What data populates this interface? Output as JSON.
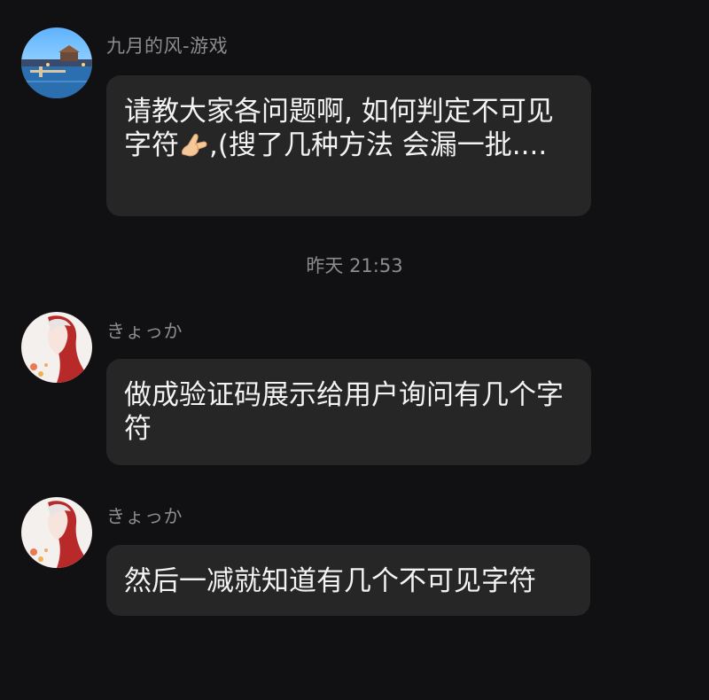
{
  "messages": [
    {
      "sender": "九月的风-游戏",
      "text_before": "请教大家各问题啊, 如何判定不可见字符",
      "emoji": "pinching-hand-emoji",
      "text_after": ",(搜了几种方法 会漏一批...."
    },
    {
      "sender": "きょっか",
      "text": "做成验证码展示给用户询问有几个字符"
    },
    {
      "sender": "きょっか",
      "text": "然后一减就知道有几个不可见字符"
    }
  ],
  "timestamp": "昨天 21:53",
  "colors": {
    "background": "#111113",
    "bubble": "#262626",
    "meta_text": "#8c8c8c",
    "message_text": "#f3f3f3"
  }
}
